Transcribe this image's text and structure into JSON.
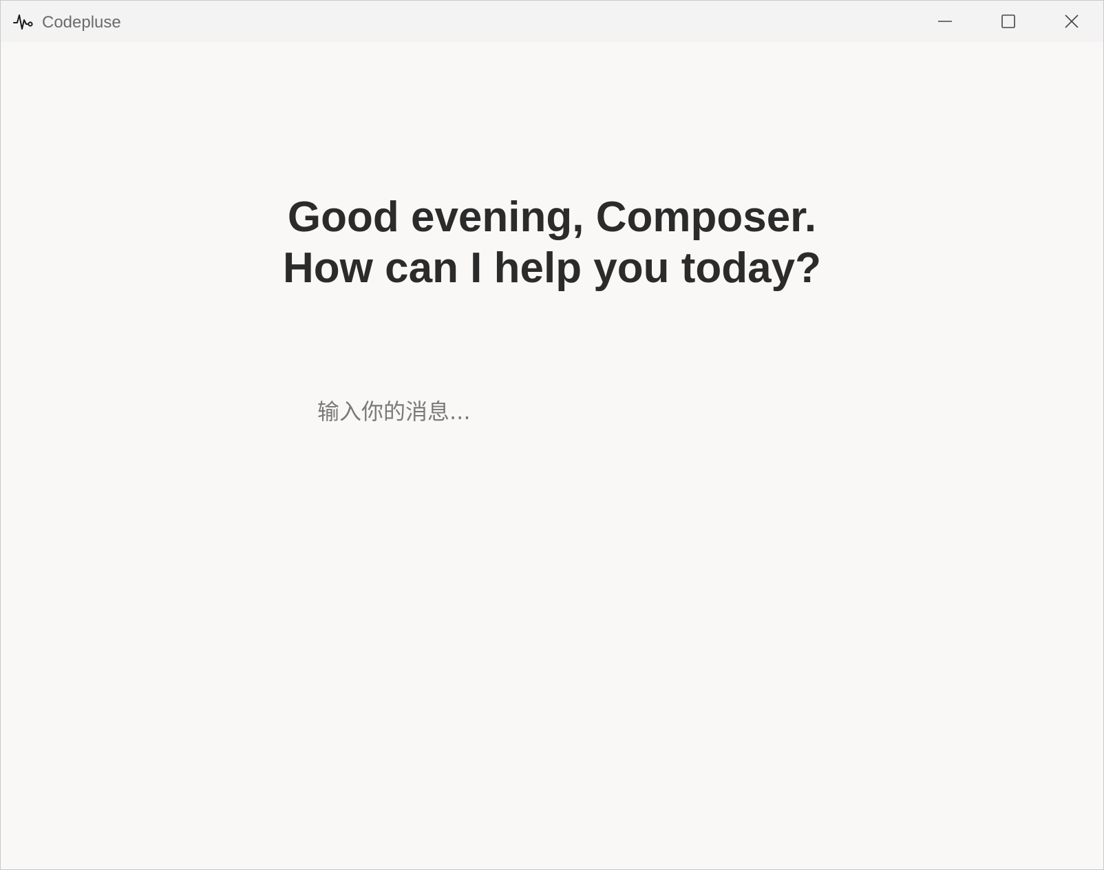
{
  "window": {
    "title": "Codepluse",
    "app_icon": "pulse-icon",
    "controls": {
      "minimize": "minimize-icon",
      "maximize": "maximize-icon",
      "close": "close-icon"
    }
  },
  "main": {
    "greeting_line1": "Good evening, Composer.",
    "greeting_line2": "How can I help you today?",
    "input": {
      "value": "",
      "placeholder": "输入你的消息..."
    }
  },
  "colors": {
    "background": "#f9f8f7",
    "titlebar": "#f3f3f3",
    "text": "#2b2b2b",
    "placeholder": "#7a7a7a"
  }
}
